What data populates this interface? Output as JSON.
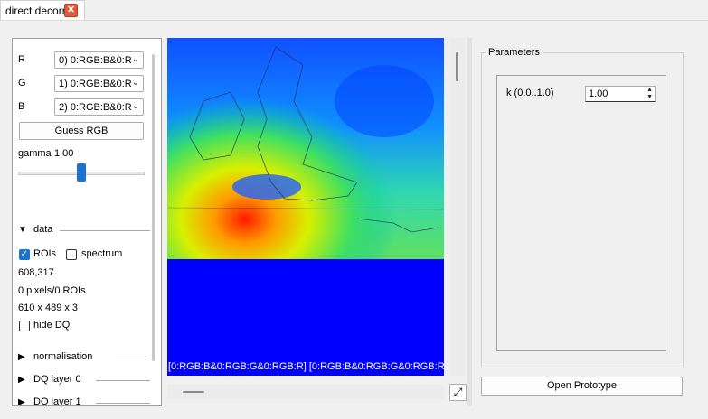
{
  "tab": {
    "label": "direct decorr",
    "close_icon": "close-icon"
  },
  "left_panel": {
    "channels": [
      {
        "label": "R",
        "value": "0) 0:RGB:B&0:R"
      },
      {
        "label": "G",
        "value": "1) 0:RGB:B&0:R"
      },
      {
        "label": "B",
        "value": "2) 0:RGB:B&0:R"
      }
    ],
    "guess_rgb_label": "Guess RGB",
    "gamma_label": "gamma",
    "gamma_value": "1.00",
    "gamma_slider_fraction": 0.5,
    "data_section_label": "data",
    "rois_label": "ROIs",
    "rois_checked": true,
    "spectrum_label": "spectrum",
    "spectrum_checked": false,
    "coords": "608,317",
    "pixels_rois": "0 pixels/0 ROIs",
    "dimensions": "610 x 489 x 3",
    "hide_dq_label": "hide DQ",
    "hide_dq_checked": false,
    "normalisation_label": "normalisation",
    "dq_layer0_label": "DQ layer 0",
    "dq_layer1_label": "DQ layer 1"
  },
  "image_view": {
    "caption": "[0:RGB:B&0:RGB:G&0:RGB:R] [0:RGB:B&0:RGB:G&0:RGB:R] [0:"
  },
  "parameters": {
    "title": "Parameters",
    "k_label": "k (0.0..1.0)",
    "k_value": "1.00"
  },
  "open_prototype_label": "Open Prototype",
  "colors": {
    "accent": "#1a73d0",
    "close": "#e0593e",
    "image_background": "#0000ff"
  }
}
